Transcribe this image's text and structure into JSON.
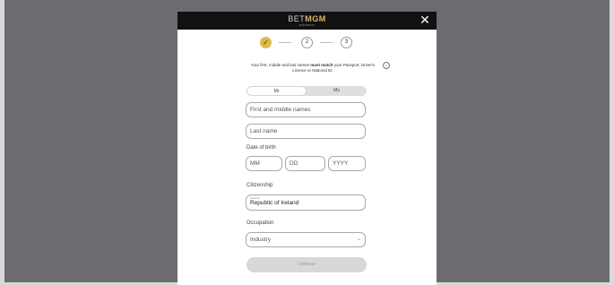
{
  "header": {
    "logo_prefix": "BET",
    "logo_brand": "MGM",
    "logo_sub": "ONTARIO",
    "close_icon": "close-icon"
  },
  "stepper": {
    "step1_icon": "check-icon",
    "step2_label": "2",
    "step3_label": "3",
    "current_step": 1,
    "accent": "#e2b84c"
  },
  "info": {
    "text_before": "Your first, middle and last names ",
    "text_bold": "must match",
    "text_after": " your Passport, Driver's Licence or National ID.",
    "icon": "info-icon",
    "icon_glyph": "i"
  },
  "gender": {
    "options": [
      "Mr",
      "Ms"
    ],
    "selected": "Mr"
  },
  "fields": {
    "first_name_placeholder": "First and middle names",
    "last_name_placeholder": "Last name",
    "dob_label": "Date of birth",
    "mm_placeholder": "MM",
    "dd_placeholder": "DD",
    "yyyy_placeholder": "YYYY",
    "citizenship_label": "Citizenship",
    "citizenship_mini": "Country",
    "citizenship_value": "Republic of Ireland",
    "occupation_label": "Occupation",
    "occupation_placeholder": "Industry"
  },
  "continue_label": "Continue",
  "colors": {
    "overlay": "#6b6b70",
    "header_bg": "#111111",
    "brand_gold": "#d9b56a",
    "disabled_button": "#d8d8d8"
  }
}
